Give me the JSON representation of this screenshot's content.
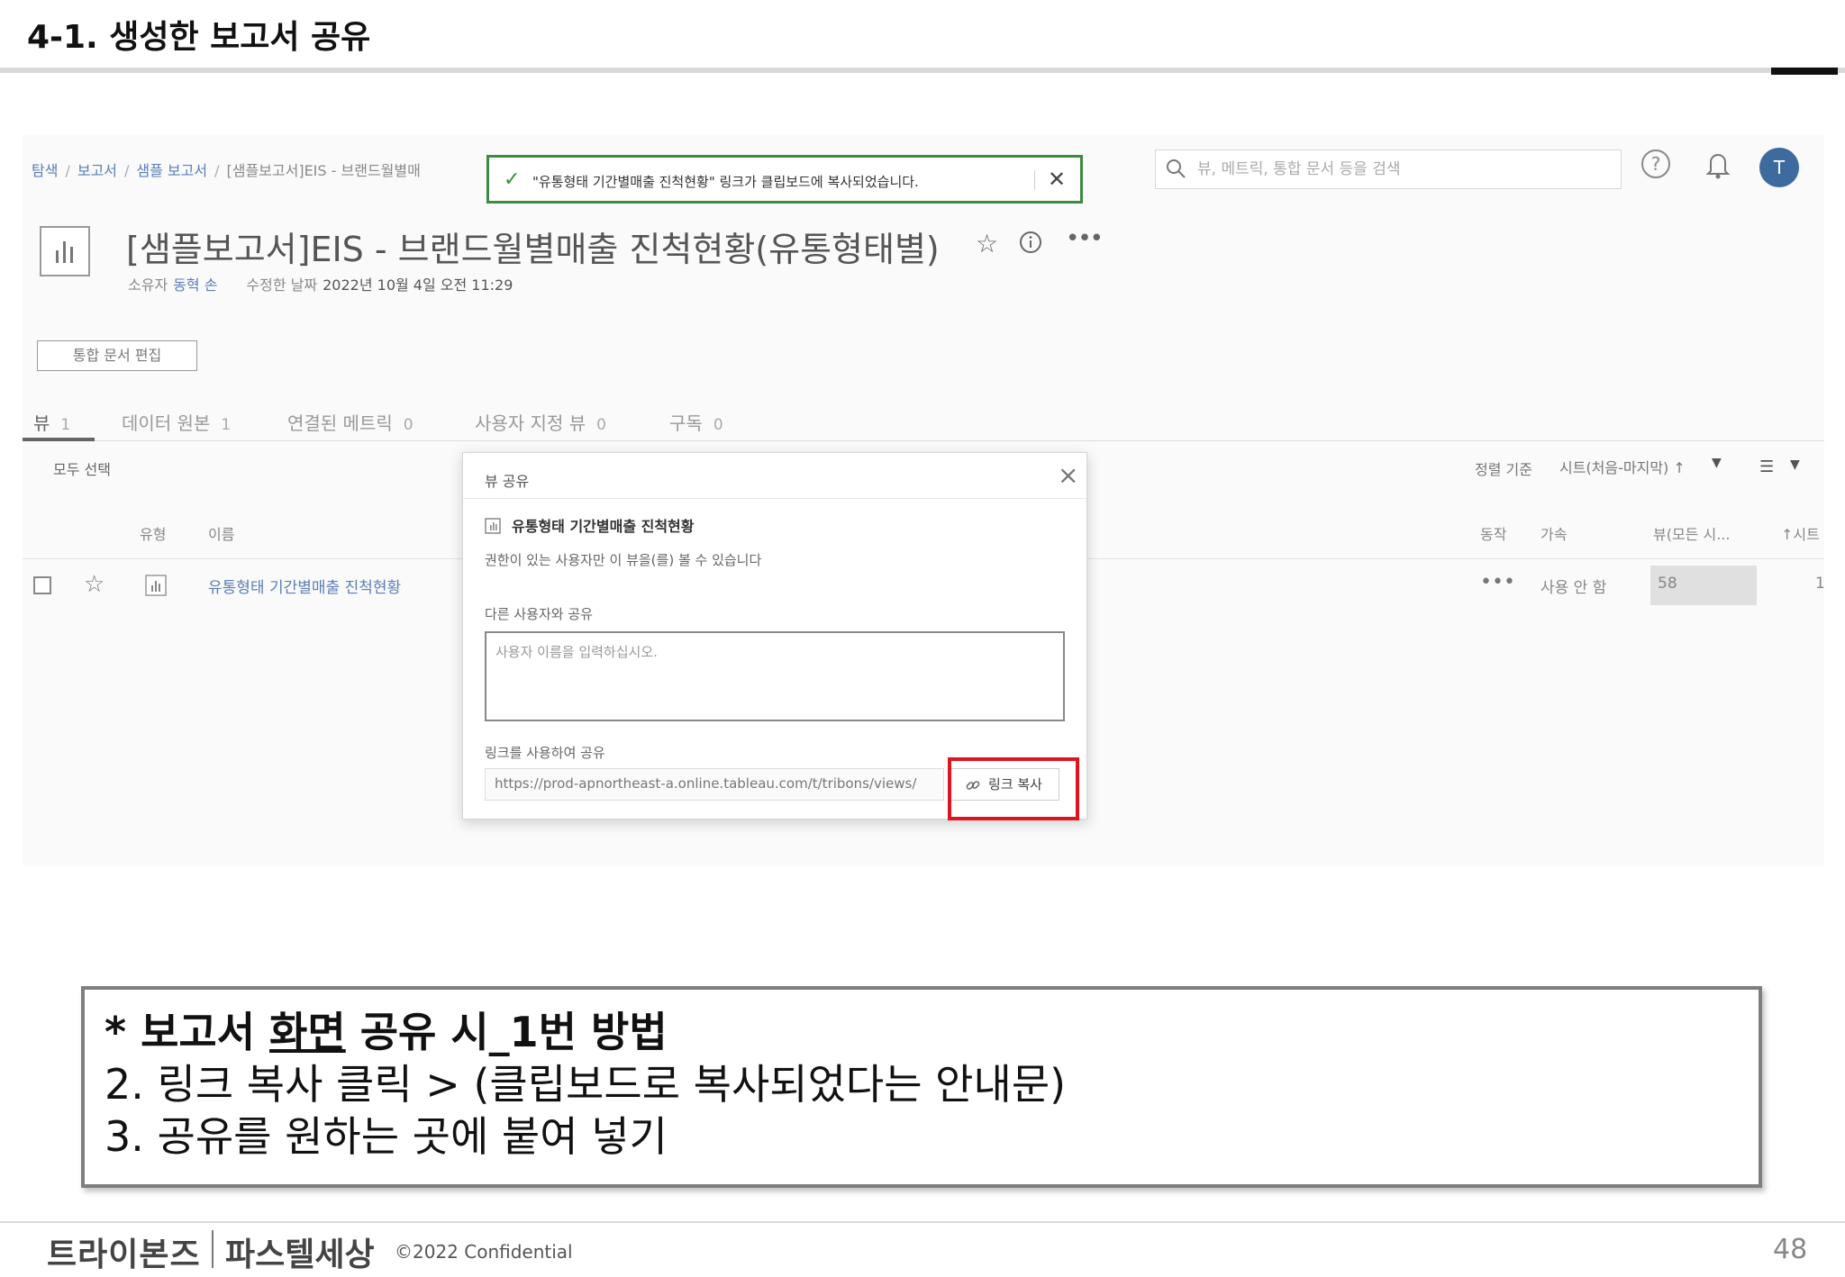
{
  "slide": {
    "title": "4-1. 생성한 보고서 공유",
    "page_number": "48",
    "copyright": "©2022 Confidential",
    "logos": [
      "트라이본즈",
      "파스텔세상"
    ]
  },
  "app": {
    "breadcrumb": {
      "items": [
        "탐색",
        "보고서",
        "샘플 보고서",
        "[샘플보고서]EIS - 브랜드월별매"
      ],
      "separator": "/"
    },
    "toast": {
      "icon": "check-icon",
      "message": "\"유통형태 기간별매출 진척현황\" 링크가 클립보드에 복사되었습니다."
    },
    "search": {
      "placeholder": "뷰, 메트릭, 통합 문서 등을 검색"
    },
    "user": {
      "avatar_initial": "T",
      "avatar_color": "#3d6b9e"
    },
    "page": {
      "title": "[샘플보고서]EIS - 브랜드월별매출 진척현황(유통형태별)",
      "owner_label": "소유자",
      "owner": "동혁 손",
      "modified_label": "수정한 날짜",
      "modified_date": "2022년 10월 4일 오전 11:29",
      "edit_button": "통합 문서 편집"
    },
    "tabs": [
      {
        "label": "뷰",
        "count": "1",
        "active": true
      },
      {
        "label": "데이터 원본",
        "count": "1",
        "active": false
      },
      {
        "label": "연결된 메트릭",
        "count": "0",
        "active": false
      },
      {
        "label": "사용자 지정 뷰",
        "count": "0",
        "active": false
      },
      {
        "label": "구독",
        "count": "0",
        "active": false
      }
    ],
    "list": {
      "select_all": "모두 선택",
      "sort_label": "정렬 기준",
      "sort_value": "시트(처음-마지막) ↑",
      "columns": {
        "type": "유형",
        "name": "이름",
        "actions": "동작",
        "visibility": "가속",
        "views": "뷰(모든 시...",
        "sheets": "↑시트"
      },
      "rows": [
        {
          "name": "유통형태 기간별매출 진척현황",
          "actions": "•••",
          "visibility": "사용 안 함",
          "views": "58",
          "sheets": "1"
        }
      ]
    },
    "share_dialog": {
      "title": "뷰 공유",
      "view_name": "유통형태 기간별매출 진척현황",
      "permission_note": "권한이 있는 사용자만 이 뷰을(를) 볼 수 있습니다",
      "share_with_label": "다른 사용자와 공유",
      "share_with_placeholder": "사용자 이름을 입력하십시오.",
      "link_label": "링크를 사용하여 공유",
      "link_value": "https://prod-apnortheast-a.online.tableau.com/t/tribons/views/",
      "copy_button": "링크 복사",
      "highlight_color": "#e0141e"
    }
  },
  "note": {
    "heading_prefix": "* 보고서 ",
    "heading_underlined": "화면",
    "heading_suffix": " 공유 시_1번 방법",
    "lines": [
      "2. 링크 복사 클릭 > (클립보드로 복사되었다는 안내문)",
      "3. 공유를 원하는 곳에 붙여 넣기"
    ]
  }
}
